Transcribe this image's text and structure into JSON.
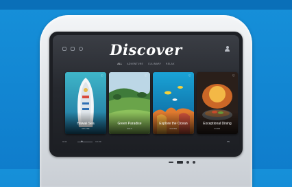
{
  "screen": {
    "title": "Discover",
    "nav": [
      "ALL",
      "ADVENTURE",
      "CULINARY",
      "RELAX"
    ],
    "nav_active": 0,
    "top_icons": [
      "home-icon",
      "grid-icon",
      "settings-icon"
    ],
    "profile_icon": "profile-icon",
    "cards": [
      {
        "title": "Hawaii Sea",
        "subtitle": "CRUISE"
      },
      {
        "title": "Green Paradise",
        "subtitle": "GOLF"
      },
      {
        "title": "Explore the Ocean",
        "subtitle": "DIVING"
      },
      {
        "title": "Exceptional Dining",
        "subtitle": "FOOD"
      }
    ],
    "bottom_bar": {
      "left_label": "9:41",
      "right_label": "10:24",
      "end_label": "EN"
    }
  }
}
